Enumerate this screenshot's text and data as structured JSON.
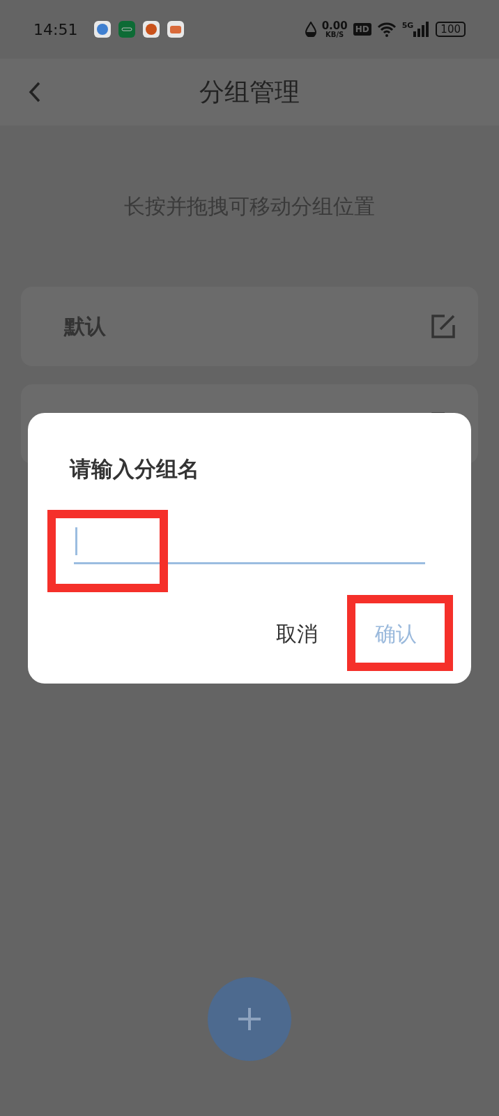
{
  "status_bar": {
    "time": "14:51",
    "speed_value": "0.00",
    "speed_unit": "KB/S",
    "hd": "HD",
    "network": "5G",
    "battery": "100"
  },
  "header": {
    "title": "分组管理"
  },
  "hint": "长按并拖拽可移动分组位置",
  "groups": [
    {
      "name": "默认"
    }
  ],
  "dialog": {
    "title": "请输入分组名",
    "buttons": [
      {
        "label": "取消",
        "disabled": false
      },
      {
        "label": "确认",
        "disabled": true
      }
    ]
  }
}
